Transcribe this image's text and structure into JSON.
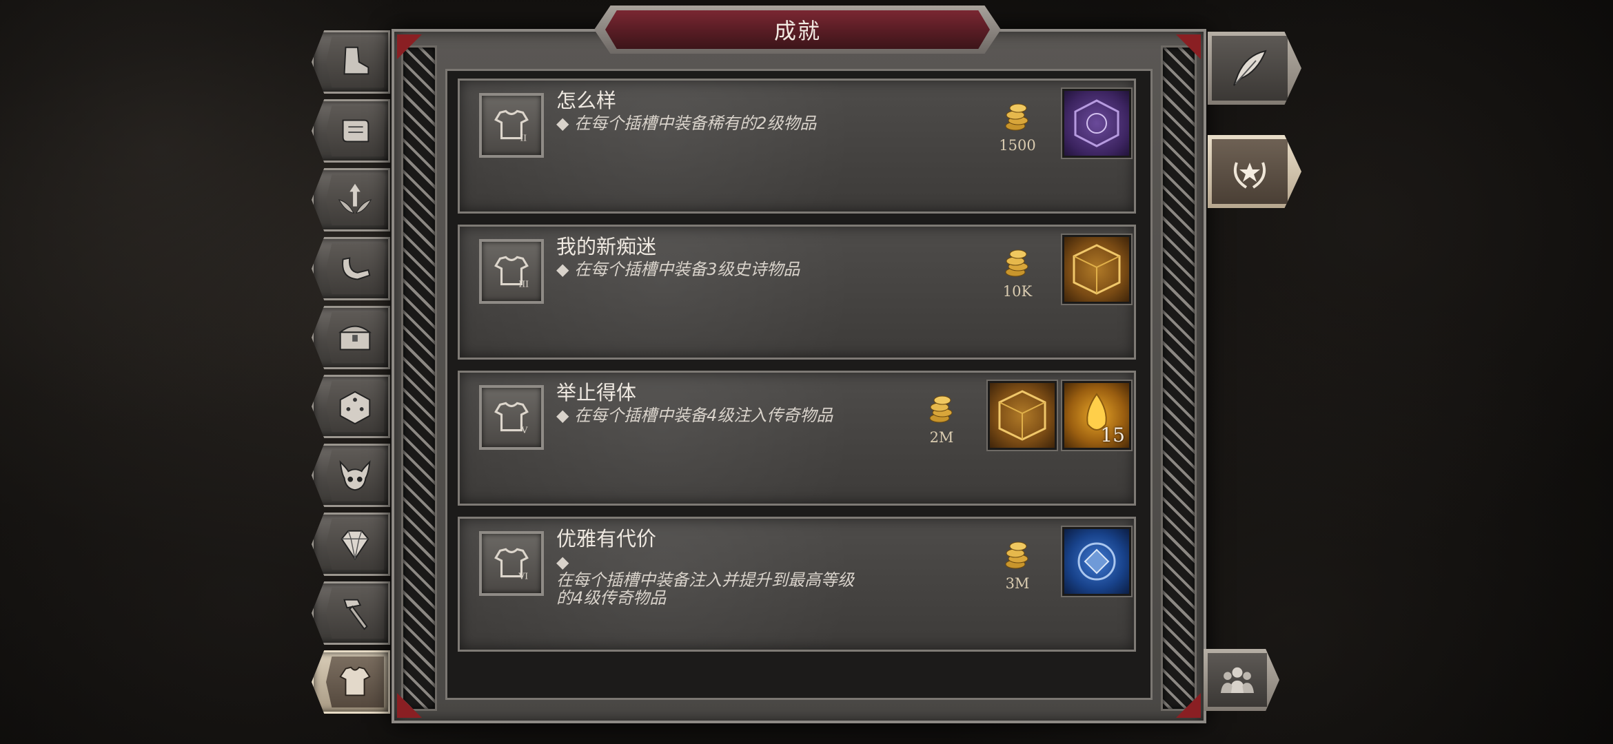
{
  "window": {
    "title": "成就"
  },
  "left_tabs": [
    {
      "icon": "boot-icon"
    },
    {
      "icon": "scroll-icon"
    },
    {
      "icon": "winged-arrow-icon"
    },
    {
      "icon": "horn-icon"
    },
    {
      "icon": "treasure-chest-icon"
    },
    {
      "icon": "dice-icon"
    },
    {
      "icon": "demon-skull-icon"
    },
    {
      "icon": "gem-icon"
    },
    {
      "icon": "hammer-icon"
    },
    {
      "icon": "armor-icon",
      "active": true
    }
  ],
  "right_tabs": [
    {
      "icon": "quill-icon"
    },
    {
      "icon": "laurel-star-icon",
      "active": true
    },
    {
      "icon": "group-icon"
    }
  ],
  "achievements": [
    {
      "title": "怎么样",
      "description": "◆ 在每个插槽中装备稀有的2级物品",
      "numeral": "II",
      "gold": "1500",
      "rewards": [
        {
          "icon": "purple-rune-cube-icon",
          "color": "#4a2a6e",
          "qty": ""
        }
      ]
    },
    {
      "title": "我的新痴迷",
      "description": "◆ 在每个插槽中装备3级史诗物品",
      "numeral": "III",
      "gold": "10K",
      "rewards": [
        {
          "icon": "golden-cube-icon",
          "color": "#7a4b14",
          "qty": ""
        }
      ]
    },
    {
      "title": "举止得体",
      "description": "◆ 在每个插槽中装备4级注入传奇物品",
      "numeral": "V",
      "gold": "2M",
      "rewards": [
        {
          "icon": "golden-cube-icon",
          "color": "#7a4b14",
          "qty": ""
        },
        {
          "icon": "amber-crystal-icon",
          "color": "#9a5e10",
          "qty": "15"
        }
      ]
    },
    {
      "title": "优雅有代价",
      "description": "◆",
      "description_2": "在每个插槽中装备注入并提升到最高等级",
      "description_3": "的4级传奇物品",
      "numeral": "VI",
      "gold": "3M",
      "rewards": [
        {
          "icon": "blue-emblem-icon",
          "color": "#18428a",
          "qty": ""
        }
      ]
    }
  ],
  "colors": {
    "title_banner": "#6b1f29",
    "panel": "#4e4c4a",
    "gold": "#d4a73a"
  }
}
